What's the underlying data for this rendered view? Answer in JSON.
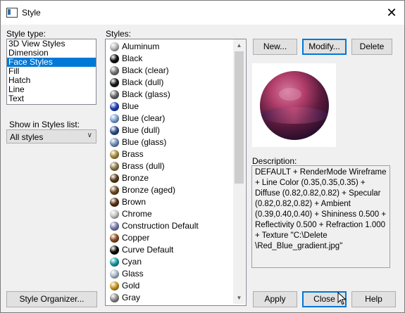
{
  "window": {
    "title": "Style"
  },
  "style_type": {
    "label": "Style type:",
    "items": [
      "3D View Styles",
      "Dimension",
      "Face Styles",
      "Fill",
      "Hatch",
      "Line",
      "Text"
    ],
    "selected_index": 2
  },
  "show_in_list": {
    "label": "Show in Styles list:",
    "value": "All styles"
  },
  "styles": {
    "label": "Styles:",
    "items": [
      {
        "name": "Aluminum",
        "color": "#b8b8b8"
      },
      {
        "name": "Black",
        "color": "#111111"
      },
      {
        "name": "Black (clear)",
        "color": "#777777"
      },
      {
        "name": "Black (dull)",
        "color": "#1a1a1a"
      },
      {
        "name": "Black (glass)",
        "color": "#666666"
      },
      {
        "name": "Blue",
        "color": "#1d3fb3"
      },
      {
        "name": "Blue (clear)",
        "color": "#7aa4d6"
      },
      {
        "name": "Blue (dull)",
        "color": "#2c4f8a"
      },
      {
        "name": "Blue (glass)",
        "color": "#6e8fb8"
      },
      {
        "name": "Brass",
        "color": "#a88a3a"
      },
      {
        "name": "Brass (dull)",
        "color": "#8c7a4a"
      },
      {
        "name": "Bronze",
        "color": "#5a3a1a"
      },
      {
        "name": "Bronze (aged)",
        "color": "#6b4a22"
      },
      {
        "name": "Brown",
        "color": "#5a2e12"
      },
      {
        "name": "Chrome",
        "color": "#c4c4c4"
      },
      {
        "name": "Construction Default",
        "color": "#7a7ab0"
      },
      {
        "name": "Copper",
        "color": "#8a4a1e"
      },
      {
        "name": "Curve Default",
        "color": "#0a0a0a"
      },
      {
        "name": "Cyan",
        "color": "#1a9aa8"
      },
      {
        "name": "Glass",
        "color": "#aab8c8"
      },
      {
        "name": "Gold",
        "color": "#c8961e"
      },
      {
        "name": "Gray",
        "color": "#8a8a8a"
      }
    ]
  },
  "buttons": {
    "new": "New...",
    "modify": "Modify...",
    "delete": "Delete",
    "style_organizer": "Style Organizer...",
    "apply": "Apply",
    "close": "Close",
    "help": "Help"
  },
  "description": {
    "label": "Description:",
    "text": "DEFAULT + RenderMode Wireframe + Line Color (0.35,0.35,0.35) + Diffuse (0.82,0.82,0.82) + Specular (0.82,0.82,0.82) + Ambient (0.39,0.40,0.40) + Shininess 0.500 + Reflectivity 0.500 + Refraction 1.000 + Texture \"C:\\Delete \\Red_Blue_gradient.jpg\""
  },
  "preview": {
    "colors": [
      "#c7567e",
      "#7a1d3f",
      "#2e1030",
      "#5a2a6e"
    ]
  }
}
